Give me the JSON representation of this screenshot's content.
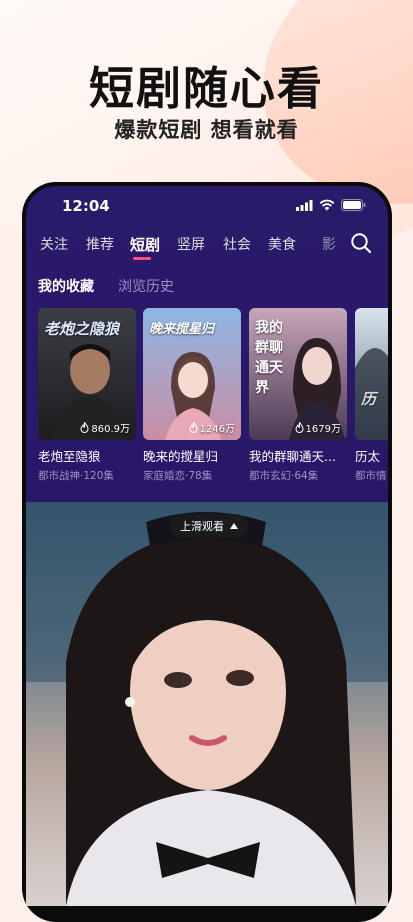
{
  "promo": {
    "headline": "短剧随心看",
    "subline": "爆款短剧 想看就看"
  },
  "status_bar": {
    "time": "12:04"
  },
  "tabs": [
    {
      "label": "关注",
      "active": false
    },
    {
      "label": "推荐",
      "active": false
    },
    {
      "label": "短剧",
      "active": true
    },
    {
      "label": "竖屏",
      "active": false
    },
    {
      "label": "社会",
      "active": false
    },
    {
      "label": "美食",
      "active": false
    },
    {
      "label": "影",
      "active": false
    }
  ],
  "subtabs": [
    {
      "label": "我的收藏",
      "active": true
    },
    {
      "label": "浏览历史",
      "active": false
    }
  ],
  "cards": [
    {
      "poster_text": "老炮之隐狼",
      "views": "860.9万",
      "title": "老炮至隐狼",
      "meta": "都市战神·120集",
      "color_top": "#3b3f45",
      "color_bottom": "#1d1c1f"
    },
    {
      "poster_text": "晚来搅星归",
      "views": "1246万",
      "title": "晚来的搅星归",
      "meta": "家庭婚恋·78集",
      "color_top": "#8fb6e4",
      "color_bottom": "#c98ea2"
    },
    {
      "poster_text": "我的群聊通天界",
      "views": "1679万",
      "title": "我的群聊通天...",
      "meta": "都市玄幻·64集",
      "color_top": "#c7a6b8",
      "color_bottom": "#4b3a55"
    },
    {
      "poster_text": "历",
      "views": "",
      "title": "历太",
      "meta": "都市情",
      "color_top": "#d8e3ec",
      "color_bottom": "#5d7086"
    }
  ],
  "video": {
    "swipe_hint": "上滑观看"
  }
}
